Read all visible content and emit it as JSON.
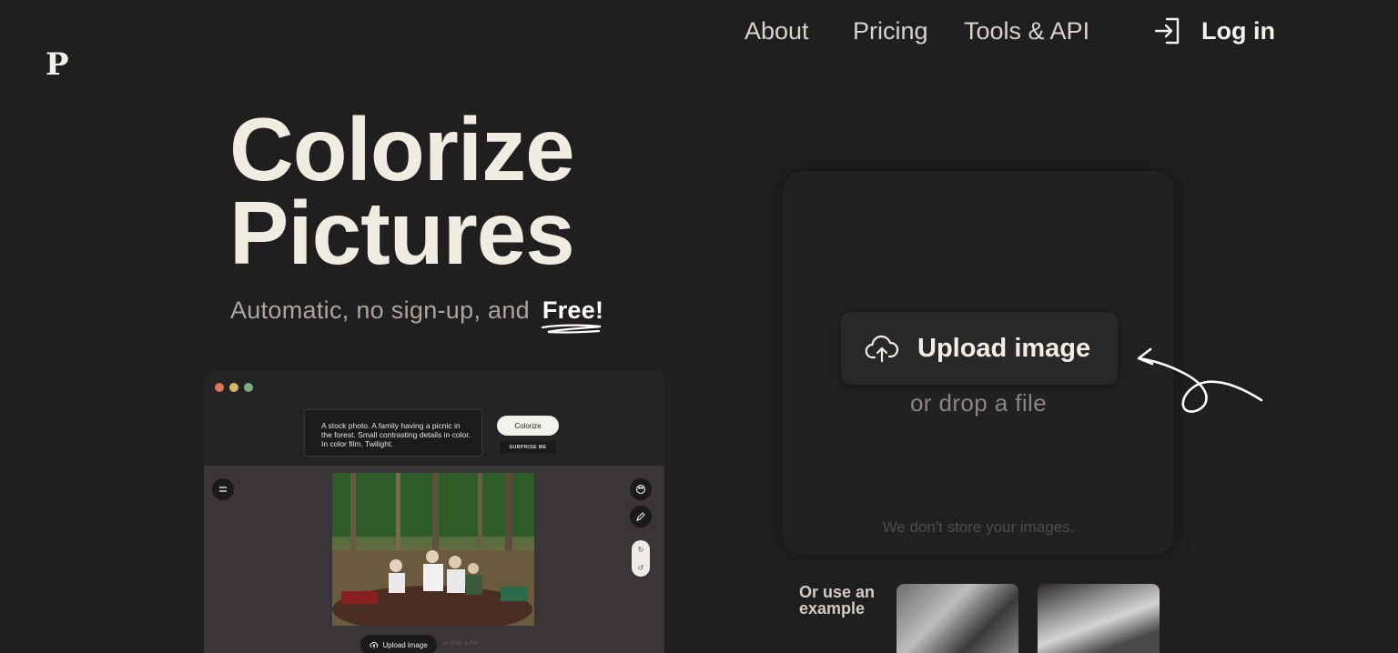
{
  "logo": "P",
  "nav": {
    "about": "About",
    "pricing": "Pricing",
    "tools": "Tools & API",
    "login": "Log in"
  },
  "hero": {
    "title_line1": "Colorize",
    "title_line2": "Pictures",
    "subtitle": "Automatic, no sign-up, and",
    "subtitle_emphasis": "Free!"
  },
  "mockup": {
    "prompt": "A stock photo. A family having a picnic in the forest. Small contrasting details in color. In color film. Twilight.",
    "colorize_button": "Colorize",
    "surprise_button": "SURPRISE ME",
    "upload_button": "Upload image",
    "drop_text": "or drop a file",
    "window_dots": [
      "#e0735a",
      "#d8b26a",
      "#74b27a"
    ]
  },
  "upload": {
    "button": "Upload image",
    "drop": "or drop a file",
    "privacy": "We don't store your images."
  },
  "examples": {
    "label_line1": "Or use an",
    "label_line2": "example"
  },
  "icons": {
    "login": "login-icon",
    "upload": "cloud-upload-icon",
    "arrow": "hand-drawn-arrow-icon"
  }
}
